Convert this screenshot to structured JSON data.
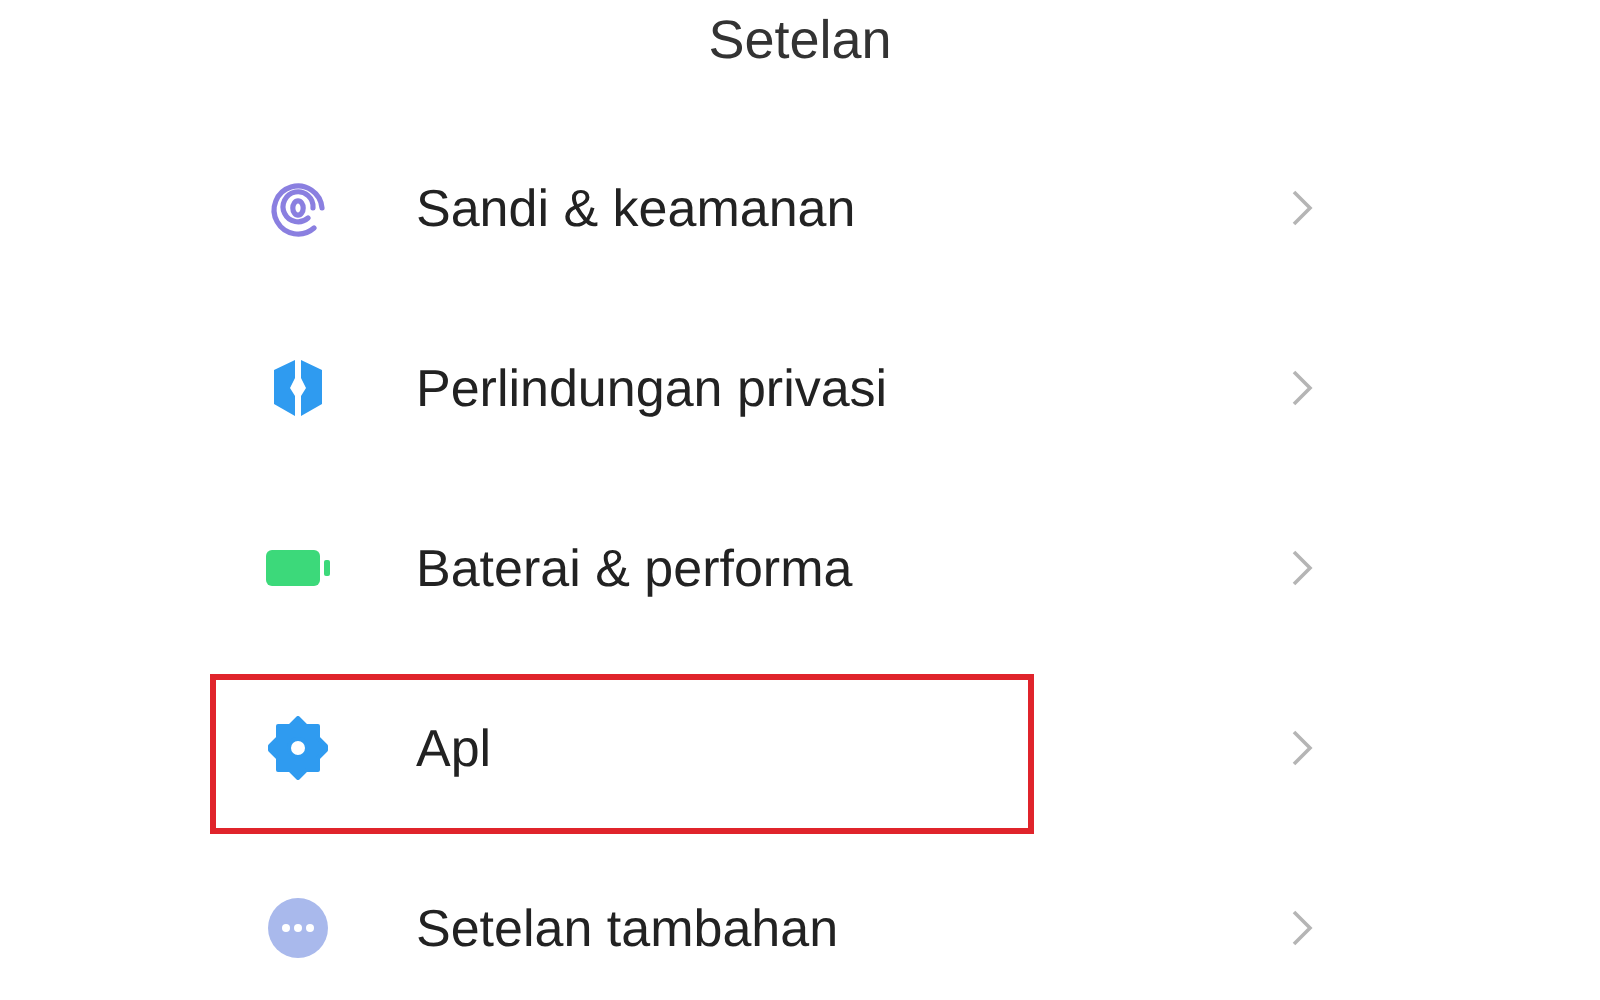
{
  "title": "Setelan",
  "items": [
    {
      "label": "Sandi & keamanan",
      "kind": "fingerprint",
      "highlighted": false
    },
    {
      "label": "Perlindungan privasi",
      "kind": "shield",
      "highlighted": false
    },
    {
      "label": "Baterai & performa",
      "kind": "battery",
      "highlighted": false
    },
    {
      "label": "Apl",
      "kind": "gear",
      "highlighted": true
    },
    {
      "label": "Setelan tambahan",
      "kind": "more",
      "highlighted": false
    }
  ]
}
